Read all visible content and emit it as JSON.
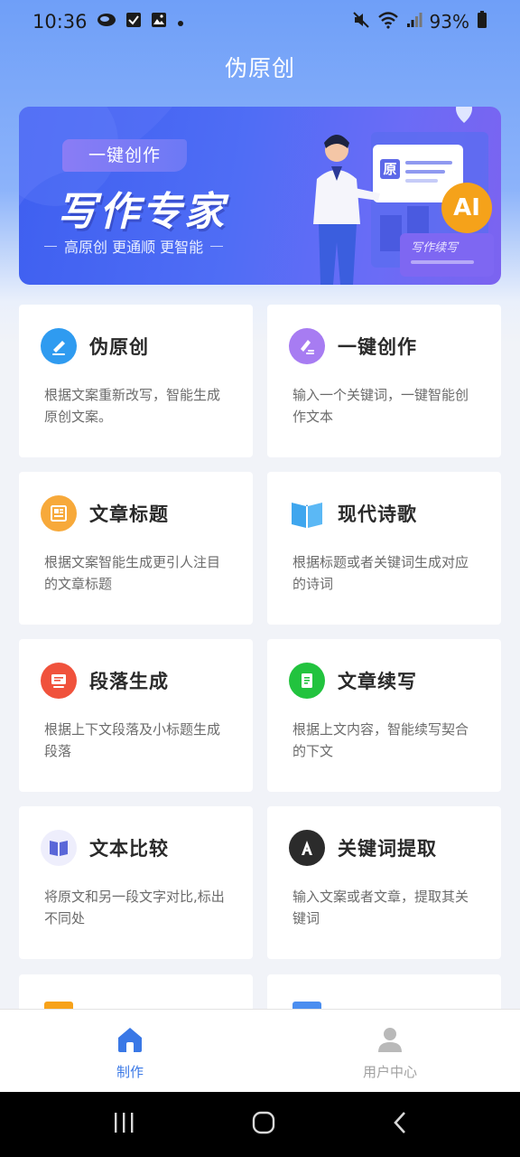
{
  "status_bar": {
    "time": "10:36",
    "battery": "93%",
    "icons": [
      "chat-bubble-icon",
      "check-square-icon",
      "image-icon",
      "dot-icon",
      "mute-icon",
      "wifi-icon",
      "signal-icon",
      "battery-icon"
    ]
  },
  "header": {
    "title": "伪原创"
  },
  "banner": {
    "tag": "一键创作",
    "headline": "写作专家",
    "subtitle": "高原创 更通顺 更智能",
    "badge": "AI",
    "doc_label": "原",
    "continue_label": "写作续写"
  },
  "cards": [
    {
      "title": "伪原创",
      "desc": "根据文案重新改写，智能生成原创文案。",
      "icon": "pencil-icon",
      "color": "#2f9bf0"
    },
    {
      "title": "一键创作",
      "desc": "输入一个关键词，一键智能创作文本",
      "icon": "pen-write-icon",
      "color": "#a77cf2"
    },
    {
      "title": "文章标题",
      "desc": "根据文案智能生成更引人注目的文章标题",
      "icon": "newspaper-icon",
      "color": "#f7a93a"
    },
    {
      "title": "现代诗歌",
      "desc": "根据标题或者关键词生成对应的诗词",
      "icon": "book-open-icon",
      "color": "#3fa6ee"
    },
    {
      "title": "段落生成",
      "desc": "根据上下文段落及小标题生成段落",
      "icon": "monitor-icon",
      "color": "#f0523c"
    },
    {
      "title": "文章续写",
      "desc": "根据上文内容，智能续写契合的下文",
      "icon": "document-icon",
      "color": "#22c33e"
    },
    {
      "title": "文本比较",
      "desc": "将原文和另一段文字对比,标出不同处",
      "icon": "compare-book-icon",
      "color": "#eeeefc"
    },
    {
      "title": "关键词提取",
      "desc": "输入文案或者文章，提取其关键词",
      "icon": "letter-a-icon",
      "color": "#2b2b2b"
    }
  ],
  "bottom_nav": [
    {
      "label": "制作",
      "icon": "home-icon",
      "active": true
    },
    {
      "label": "用户中心",
      "icon": "user-icon",
      "active": false
    }
  ],
  "accent": "#3a78e6"
}
